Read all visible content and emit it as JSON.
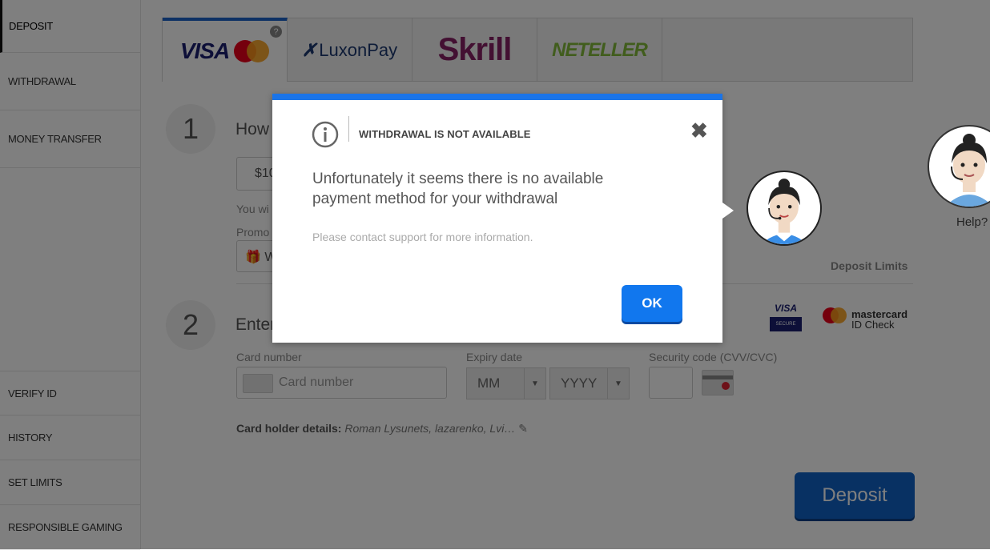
{
  "sidebar": {
    "items": [
      {
        "label": "DEPOSIT"
      },
      {
        "label": "WITHDRAWAL"
      },
      {
        "label": "MONEY TRANSFER"
      },
      {
        "label": "VERIFY ID"
      },
      {
        "label": "HISTORY"
      },
      {
        "label": "SET LIMITS"
      },
      {
        "label": "RESPONSIBLE GAMING"
      }
    ]
  },
  "tabs": {
    "visa": "VISA",
    "help_mark": "?",
    "luxon": "LuxonPay",
    "skrill": "Skrill",
    "neteller": "NETELLER"
  },
  "form": {
    "step1_number": "1",
    "step1_title": "How",
    "amount_value": "$10",
    "you_will_text": "You wi",
    "promo_label": "Promo",
    "promo_value": "W",
    "deposit_limits": "Deposit Limits",
    "step2_number": "2",
    "step2_title": "Enter",
    "card_number_label": "Card number",
    "card_number_placeholder": "Card number",
    "expiry_label": "Expiry date",
    "month_value": "MM",
    "year_value": "YYYY",
    "cvv_label": "Security code (CVV/CVC)",
    "card_holder_label": "Card holder details:",
    "card_holder_value": "Roman Lysunets, lazarenko, Lvi…",
    "deposit_button": "Deposit",
    "visa_secure_top": "VISA",
    "visa_secure_bottom": "SECURE",
    "mastercard_id_top": "mastercard",
    "mastercard_id_bottom": "ID Check"
  },
  "help": {
    "label": "Help?"
  },
  "modal": {
    "title": "WITHDRAWAL IS NOT AVAILABLE",
    "message": "Unfortunately it seems there is no available payment method for your withdrawal",
    "sub_message": "Please contact support for more information.",
    "ok_label": "OK",
    "close_symbol": "✖"
  },
  "colors": {
    "accent": "#1a74e8",
    "ok_button": "#1177ee",
    "deposit_button": "#1063c7",
    "visa": "#1a1f71",
    "skrill": "#862165",
    "neteller": "#83ba3b"
  }
}
